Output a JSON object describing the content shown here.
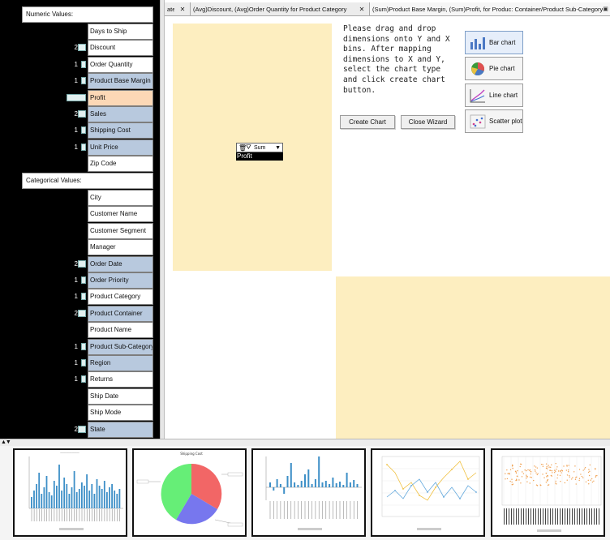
{
  "numeric_header": "Numeric Values:",
  "categorical_header": "Categorical Values:",
  "numeric_fields": [
    {
      "label": "Days to Ship",
      "count": "",
      "state": "plain",
      "bar": 0
    },
    {
      "label": "Discount",
      "count": "2",
      "state": "plain",
      "bar": 2
    },
    {
      "label": "Order Quantity",
      "count": "1",
      "state": "plain",
      "bar": 1
    },
    {
      "label": "Product Base Margin",
      "count": "1",
      "state": "used",
      "bar": 1
    },
    {
      "label": "Profit",
      "count": "5",
      "state": "selected",
      "bar": 5
    },
    {
      "label": "Sales",
      "count": "2",
      "state": "used",
      "bar": 2
    },
    {
      "label": "Shipping Cost",
      "count": "1",
      "state": "used",
      "bar": 1
    },
    {
      "label": "Unit Price",
      "count": "1",
      "state": "used",
      "bar": 1
    },
    {
      "label": "Zip Code",
      "count": "",
      "state": "plain",
      "bar": 0
    }
  ],
  "categorical_fields": [
    {
      "label": "City",
      "count": "",
      "state": "plain",
      "bar": 0
    },
    {
      "label": "Customer Name",
      "count": "",
      "state": "plain",
      "bar": 0
    },
    {
      "label": "Customer Segment",
      "count": "",
      "state": "plain",
      "bar": 0
    },
    {
      "label": "Manager",
      "count": "",
      "state": "plain",
      "bar": 0
    },
    {
      "label": "Order Date",
      "count": "2",
      "state": "used",
      "bar": 2
    },
    {
      "label": "Order Priority",
      "count": "1",
      "state": "used",
      "bar": 1
    },
    {
      "label": "Product Category",
      "count": "1",
      "state": "plain",
      "bar": 1
    },
    {
      "label": "Product Container",
      "count": "2",
      "state": "used",
      "bar": 2
    },
    {
      "label": "Product Name",
      "count": "",
      "state": "plain",
      "bar": 0
    },
    {
      "label": "Product Sub-Category",
      "count": "1",
      "state": "used",
      "bar": 1
    },
    {
      "label": "Region",
      "count": "1",
      "state": "used",
      "bar": 1
    },
    {
      "label": "Returns",
      "count": "1",
      "state": "plain",
      "bar": 1
    },
    {
      "label": "Ship Date",
      "count": "",
      "state": "plain",
      "bar": 0
    },
    {
      "label": "Ship Mode",
      "count": "",
      "state": "plain",
      "bar": 0
    },
    {
      "label": "State",
      "count": "2",
      "state": "used",
      "bar": 2
    }
  ],
  "tabs": [
    {
      "label": "ate"
    },
    {
      "label": "(Avg)Discount, (Avg)Order Quantity for Product Category"
    },
    {
      "label": "(Sum)Product Base Margin, (Sum)Profit, for Produc: Container/Product Sub-Category"
    }
  ],
  "measure_chip": {
    "aggregation": "Sum",
    "field": "Profit"
  },
  "instructions": "Please drag and drop dimensions onto Y and X bins. After mapping dimensions to X and Y, select the chart type and click create chart button.",
  "buttons": {
    "create_chart": "Create Chart",
    "close_wizard": "Close Wizard"
  },
  "chart_types": [
    {
      "label": "Bar chart",
      "icon": "bar-chart-icon",
      "active": true
    },
    {
      "label": "Pie chart",
      "icon": "pie-chart-icon",
      "active": false
    },
    {
      "label": "Line chart",
      "icon": "line-chart-icon",
      "active": false
    },
    {
      "label": "Scatter plot",
      "icon": "scatter-plot-icon",
      "active": false
    }
  ],
  "thumbnails": [
    {
      "kind": "bar-chart-thumbnail"
    },
    {
      "kind": "pie-chart-thumbnail",
      "title": "Shipping Cost"
    },
    {
      "kind": "bar-chart-thumbnail-2"
    },
    {
      "kind": "line-chart-thumbnail"
    },
    {
      "kind": "scatter-chart-thumbnail"
    }
  ],
  "colors": {
    "drop_zone": "#fdeec0",
    "used_field": "#b8c9de",
    "selected_field": "#fcd8b6",
    "bar_blue": "#3d8fc7",
    "pie_red": "#f26666",
    "pie_green": "#66ee77",
    "pie_blue": "#7777ee",
    "scatter_orange": "#f0a050"
  }
}
